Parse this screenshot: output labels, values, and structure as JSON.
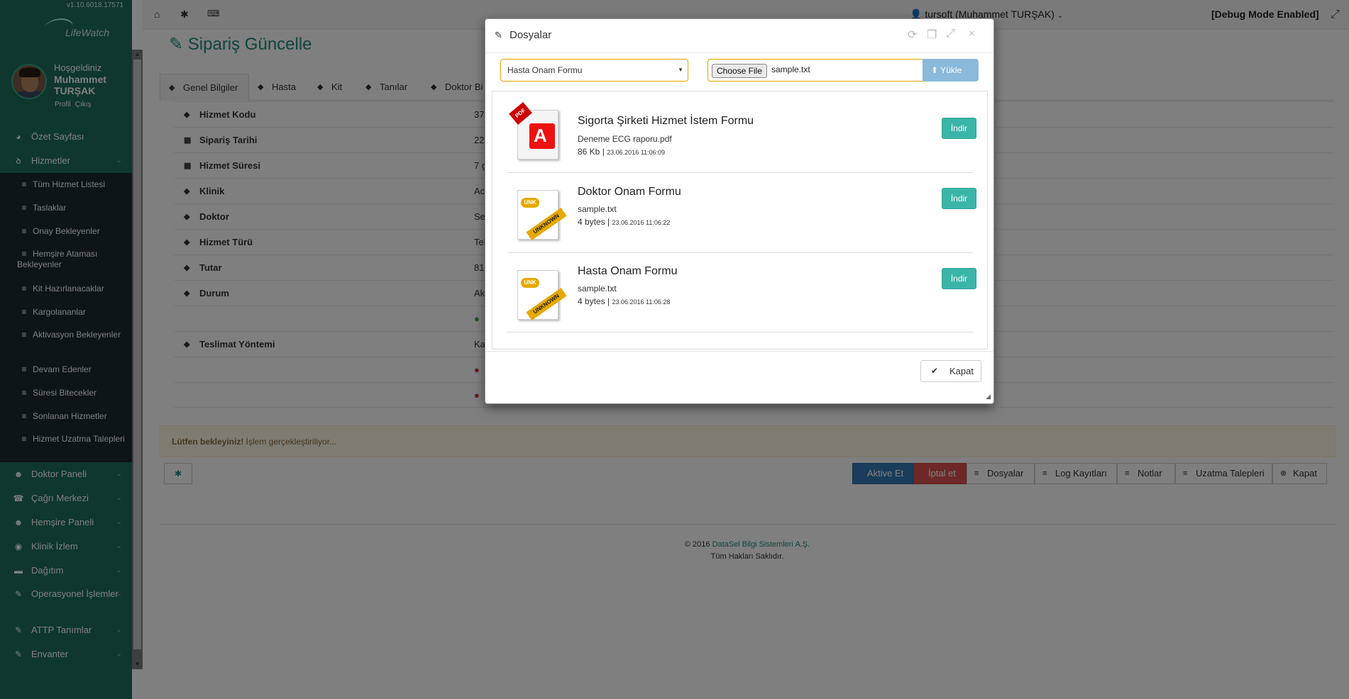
{
  "sidebar": {
    "version": "v1.10.6018.17571",
    "logo_text": "LifeWatch",
    "welcome": "Hoşgeldiniz",
    "user_first": "Muhammet",
    "user_last": "TURŞAK",
    "profile_link": "Profil",
    "logout_link": "Çıkış",
    "menu": [
      {
        "label": "Özet Sayfası",
        "icon": "dashboard-icon"
      },
      {
        "label": "Hizmetler",
        "icon": "stethoscope-icon"
      },
      {
        "label": "Doktor Paneli",
        "icon": "user-doctor-icon"
      },
      {
        "label": "Çağrı Merkezi",
        "icon": "phone-icon"
      },
      {
        "label": "Hemşire Paneli",
        "icon": "user-nurse-icon"
      },
      {
        "label": "Klinik İzlem",
        "icon": "eye-icon"
      },
      {
        "label": "Dağıtım",
        "icon": "truck-icon"
      },
      {
        "label": "Operasyonel İşlemler",
        "icon": "wrench-icon"
      },
      {
        "label": "ATTP Tanımlar",
        "icon": "wrench-icon"
      },
      {
        "label": "Envanter",
        "icon": "wrench-icon"
      }
    ],
    "submenu": [
      "Tüm Hizmet Listesi",
      "Taslaklar",
      "Onay Bekleyenler",
      "Hemşire Ataması Bekleyenler",
      "Kit Hazırlanacaklar",
      "Kargolananlar",
      "Aktivasyon Bekleyenler",
      "Devam Edenler",
      "Süresi Bitecekler",
      "Sonlanan Hizmetler",
      "Hizmet Uzatma Talepleri"
    ]
  },
  "topbar": {
    "user_login": "tursoft",
    "user_name": "(Muhammet TURŞAK)",
    "debug": "[Debug Mode Enabled]"
  },
  "page": {
    "title": "Sipariş Güncelle",
    "tabs": [
      "Genel Bilgiler",
      "Hasta",
      "Kit",
      "Tanılar",
      "Doktor Bi"
    ],
    "fields": [
      {
        "label": "Hizmet Kodu",
        "value": "37",
        "icon": "tags-icon"
      },
      {
        "label": "Sipariş Tarihi",
        "value": "22",
        "icon": "calendar-icon"
      },
      {
        "label": "Hizmet Süresi",
        "value": "7 g",
        "icon": "calendar-icon"
      },
      {
        "label": "Klinik",
        "value": "Ac",
        "icon": "tags-icon"
      },
      {
        "label": "Doktor",
        "value": "Se",
        "icon": "tags-icon"
      },
      {
        "label": "Hizmet Türü",
        "value": "Tel",
        "icon": "tags-icon"
      },
      {
        "label": "Tutar",
        "value": "81",
        "icon": "tags-icon"
      },
      {
        "label": "Durum",
        "value": "Ak",
        "icon": "tags-icon"
      },
      {
        "label": "",
        "value": "",
        "icon": "check-circle-icon"
      },
      {
        "label": "Teslimat Yöntemi",
        "value": "Ka",
        "icon": "tags-icon"
      },
      {
        "label": "",
        "value": "",
        "icon": "x-circle-icon"
      },
      {
        "label": "",
        "value": "",
        "icon": "x-circle-icon"
      }
    ],
    "alert_bold": "Lütfen bekleyiniz!",
    "alert_text": " İşlem gerçekleştiriliyor...",
    "actions": [
      "Aktive Et",
      "İptal et",
      "Dosyalar",
      "Log Kayıtları",
      "Notlar",
      "Uzatma Talepleri",
      "Kapat"
    ],
    "footer_year": "© 2016",
    "footer_company": "DataSel Bilgi Sistemleri A.Ş.",
    "footer_rights": "Tüm Hakları Saklıdır."
  },
  "modal": {
    "title": "Dosyalar",
    "select_value": "Hasta Onam Formu",
    "choose_file": "Choose File",
    "file_name": "sample.txt",
    "upload_label": "Yükle",
    "download_label": "İndir",
    "close_label": "Kapat",
    "files": [
      {
        "title": "Sigorta Şirketi Hizmet İstem Formu",
        "file": "Deneme ECG raporu.pdf",
        "size": "86 Kb",
        "date": "23.06.2016 11:06:09",
        "icon": "pdf-file-icon"
      },
      {
        "title": "Doktor Onam Formu",
        "file": "sample.txt",
        "size": "4 bytes",
        "date": "23.06.2016 11:06:22",
        "icon": "unknown-file-icon"
      },
      {
        "title": "Hasta Onam Formu",
        "file": "sample.txt",
        "size": "4 bytes",
        "date": "23.06.2016 11:06:28",
        "icon": "unknown-file-icon"
      }
    ]
  }
}
